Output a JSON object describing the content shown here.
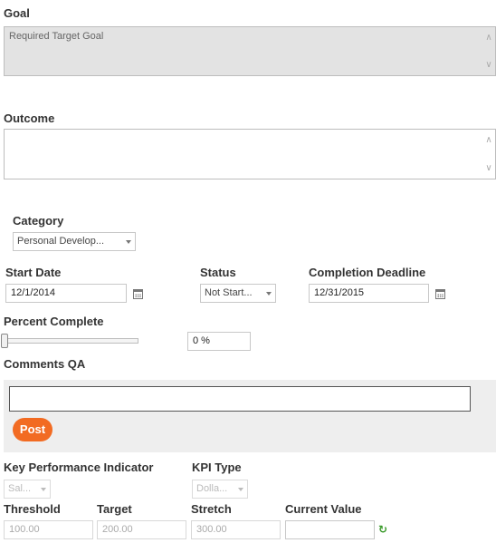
{
  "goal": {
    "label": "Goal",
    "value": "Required Target Goal"
  },
  "outcome": {
    "label": "Outcome",
    "value": ""
  },
  "category": {
    "label": "Category",
    "selected": "Personal Develop..."
  },
  "start_date": {
    "label": "Start Date",
    "value": "12/1/2014"
  },
  "status": {
    "label": "Status",
    "selected": "Not Start..."
  },
  "completion_deadline": {
    "label": "Completion Deadline",
    "value": "12/31/2015"
  },
  "percent_complete": {
    "label": "Percent Complete",
    "value_text": "0 %",
    "fraction": 0.0
  },
  "comments": {
    "label": "Comments QA",
    "input_value": "",
    "post_label": "Post"
  },
  "kpi": {
    "label": "Key Performance Indicator",
    "selected": "Sal...",
    "type_label": "KPI Type",
    "type_selected": "Dolla..."
  },
  "thresholds": {
    "threshold_label": "Threshold",
    "threshold_value": "100.00",
    "target_label": "Target",
    "target_value": "200.00",
    "stretch_label": "Stretch",
    "stretch_value": "300.00",
    "current_label": "Current Value",
    "current_value": ""
  },
  "icons": {
    "calendar": "calendar-icon",
    "refresh": "refresh-icon"
  },
  "colors": {
    "post_button": "#f26b22",
    "refresh_icon": "#3a9a2a"
  }
}
